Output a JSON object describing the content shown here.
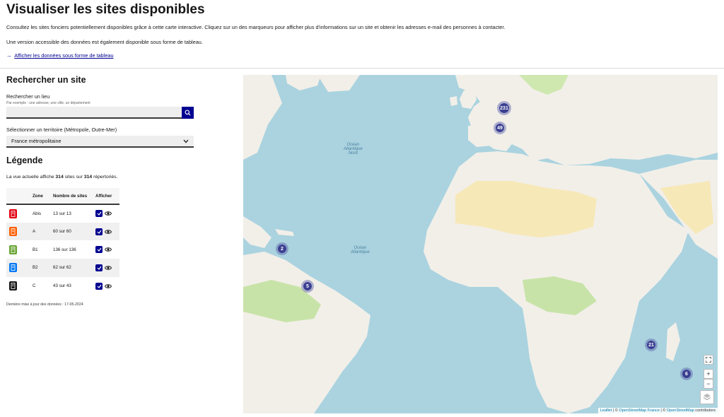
{
  "header": {
    "title": "Visualiser les sites disponibles",
    "intro": "Consultez les sites fonciers potentiellement disponibles grâce à cette carte interactive. Cliquez sur un des marqueurs pour afficher plus d'informations sur un site et obtenir les adresses e-mail des personnes à contacter.",
    "intro2": "Une version accessible des données est également disponible sous forme de tableau.",
    "table_link": "Afficher les données sous forme de tableau"
  },
  "search": {
    "title": "Rechercher un site",
    "label": "Rechercher un lieu",
    "hint": "Par exemple : une adresse, une ville, un département",
    "value": "",
    "territory_label": "Sélectionner un territoire (Métropole, Outre-Mer)",
    "territory_value": "France métropolitaine"
  },
  "legend": {
    "title": "Légende",
    "summary_prefix": "La vue actuelle affiche",
    "shown": "314",
    "summary_mid": "sites sur",
    "total": "314",
    "summary_suffix": "répertoriés.",
    "headers": [
      "Zone",
      "Nombre de sites",
      "Afficher"
    ],
    "rows": [
      {
        "zone": "Abis",
        "count": "13 sur 13",
        "color": "#e1000f"
      },
      {
        "zone": "A",
        "count": "60 sur 60",
        "color": "#fc5d00"
      },
      {
        "zone": "B1",
        "count": "136 sur 136",
        "color": "#68a532"
      },
      {
        "zone": "B2",
        "count": "62 sur 62",
        "color": "#0078f3"
      },
      {
        "zone": "C",
        "count": "43 sur 43",
        "color": "#161616"
      }
    ],
    "update_note": "Dernière mise à jour des données : 17-05-2024"
  },
  "map": {
    "clusters": [
      "231",
      "49",
      "2",
      "5",
      "21",
      "6"
    ],
    "labels": {
      "ocean_nord": "Océan\nAtlantique\nNord",
      "ocean": "Océan\nAtlantique"
    },
    "zoom_in": "+",
    "zoom_out": "−",
    "attribution": {
      "leaflet": "Leaflet",
      "sep1": " | © ",
      "osm_fr": "OpenStreetMap France",
      "sep2": " | © ",
      "osm": "OpenStreetMap",
      "suffix": " contributors"
    }
  }
}
